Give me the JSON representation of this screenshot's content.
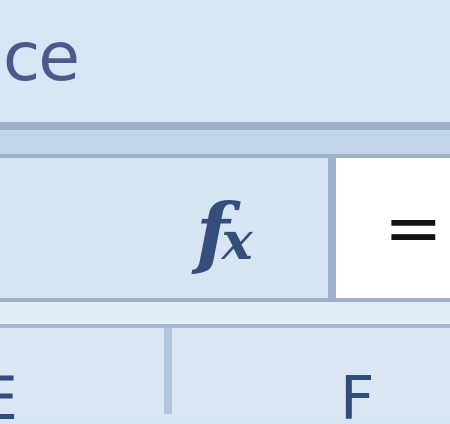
{
  "ribbon": {
    "visible_text": "ice"
  },
  "formula_bar": {
    "fx_label": "fx",
    "formula_text": "="
  },
  "column_headers": [
    "E",
    "F"
  ]
}
